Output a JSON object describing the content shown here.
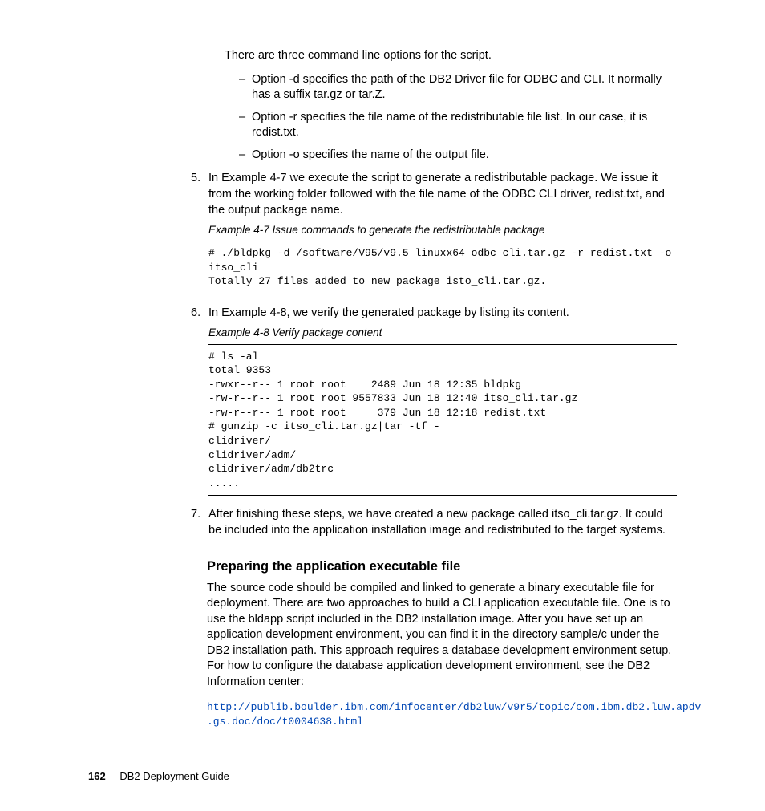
{
  "intro": "There are three command line options for the script.",
  "options": [
    "Option -d specifies the path of the DB2 Driver file for ODBC and CLI. It normally has a suffix tar.gz or tar.Z.",
    "Option -r specifies the file name of the redistributable file list. In our case, it is redist.txt.",
    "Option -o specifies the name of the output file."
  ],
  "step5": {
    "num": "5.",
    "text": "In Example 4-7 we execute the script to generate a redistributable package. We issue it from the working folder followed with the file name of the ODBC CLI driver, redist.txt, and the output package name.",
    "example_label": "Example 4-7   Issue commands to generate the redistributable package",
    "code": "# ./bldpkg -d /software/V95/v9.5_linuxx64_odbc_cli.tar.gz -r redist.txt -o \nitso_cli\nTotally 27 files added to new package isto_cli.tar.gz."
  },
  "step6": {
    "num": "6.",
    "text": "In Example 4-8, we verify the generated package by listing its content.",
    "example_label": "Example 4-8   Verify package content",
    "code": "# ls -al\ntotal 9353\n-rwxr--r-- 1 root root    2489 Jun 18 12:35 bldpkg\n-rw-r--r-- 1 root root 9557833 Jun 18 12:40 itso_cli.tar.gz\n-rw-r--r-- 1 root root     379 Jun 18 12:18 redist.txt\n# gunzip -c itso_cli.tar.gz|tar -tf -\nclidriver/\nclidriver/adm/\nclidriver/adm/db2trc\n....."
  },
  "step7": {
    "num": "7.",
    "text": "After finishing these steps, we have created a new package called itso_cli.tar.gz. It could be included into the application installation image and redistributed to the target systems."
  },
  "subhead": "Preparing the application executable file",
  "subpara": "The source code should be compiled and linked to generate a binary executable file for deployment. There are two approaches to build a CLI application executable file. One is to use the bldapp script included in the DB2 installation image. After you have set up an application development environment, you can find it in the directory sample/c under the DB2 installation path. This approach requires a database development environment setup. For how to configure the database application development environment, see the DB2 Information center:",
  "link1": "http://publib.boulder.ibm.com/infocenter/db2luw/v9r5/topic/com.ibm.db2.luw.apdv",
  "link2": ".gs.doc/doc/t0004638.html",
  "footer": {
    "page": "162",
    "title": "DB2 Deployment Guide"
  }
}
